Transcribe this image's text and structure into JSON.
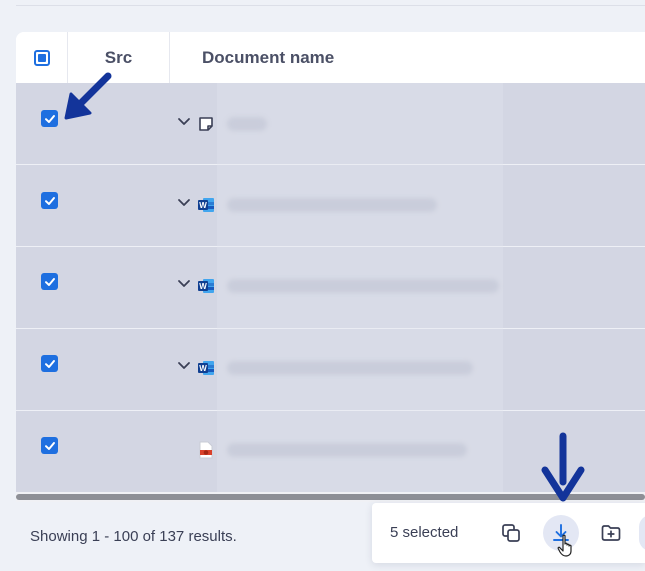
{
  "table": {
    "columns": {
      "src": "Src",
      "name": "Document name"
    },
    "rows": [
      {
        "checked": true,
        "file_type": "note-icon",
        "expandable": true,
        "name_blurred": true
      },
      {
        "checked": true,
        "file_type": "word-icon",
        "expandable": true,
        "name_blurred": true
      },
      {
        "checked": true,
        "file_type": "word-icon",
        "expandable": true,
        "name_blurred": true
      },
      {
        "checked": true,
        "file_type": "word-icon",
        "expandable": true,
        "name_blurred": true
      },
      {
        "checked": true,
        "file_type": "pdf-icon",
        "expandable": false,
        "name_blurred": true
      }
    ]
  },
  "footer": {
    "results_text": "Showing 1 - 100 of 137 results."
  },
  "action_bar": {
    "selected_text": "5 selected",
    "actions": [
      "copy-icon",
      "download-icon",
      "add-folder-icon"
    ]
  },
  "colors": {
    "accent": "#1e6fe0",
    "annotation_arrow": "#13349a",
    "selected_row_bg": "#d3d6e3"
  }
}
